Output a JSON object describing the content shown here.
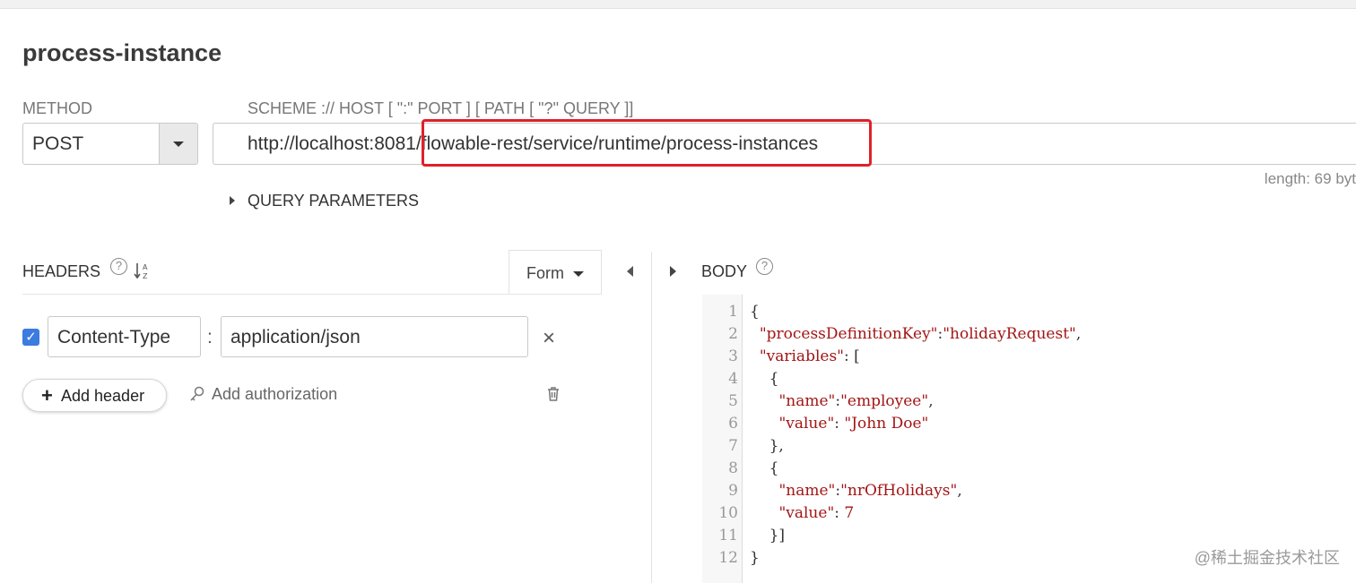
{
  "request": {
    "title": "process-instance",
    "method_label": "METHOD",
    "method_value": "POST",
    "url_label": "SCHEME :// HOST [ \":\" PORT ] [ PATH [ \"?\" QUERY ]]",
    "url_value": "http://localhost:8081/flowable-rest/service/runtime/process-instances",
    "length": "length: 69 byt",
    "query_parameters": "QUERY PARAMETERS"
  },
  "headers": {
    "label": "HEADERS",
    "form_label": "Form",
    "rows": [
      {
        "name": "Content-Type",
        "value": "application/json",
        "checked": true
      }
    ],
    "add_header": "Add header",
    "add_authorization": "Add authorization"
  },
  "body": {
    "label": "BODY",
    "line_numbers": [
      "1",
      "2",
      "3",
      "4",
      "5",
      "6",
      "7",
      "8",
      "9",
      "10",
      "11",
      "12"
    ]
  },
  "watermark": "@稀土掘金技术社区",
  "colors": {
    "accent": "#3c7be0",
    "highlight": "#e0202a",
    "code_string": "#a31515"
  }
}
